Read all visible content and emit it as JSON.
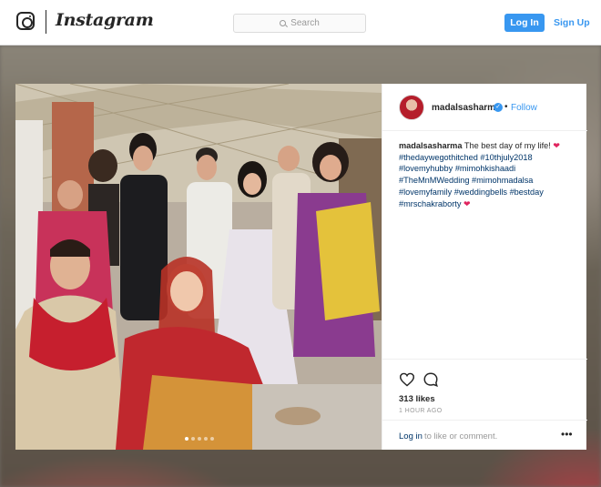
{
  "header": {
    "brand": "Instagram",
    "search_placeholder": "Search",
    "login_label": "Log In",
    "signup_label": "Sign Up"
  },
  "post": {
    "username": "madalsasharma",
    "follow_label": "Follow",
    "dot": "•",
    "caption_user": "madalsasharma",
    "caption_text": "The best day of my life!",
    "hashtags": [
      "#thedaywegothitched",
      "#10thjuly2018",
      "#lovemyhubby",
      "#mimohkishaadi",
      "#TheMnMWedding",
      "#mimohmadalsa",
      "#lovemyfamily",
      "#weddingbells",
      "#bestday",
      "#mrschakraborty"
    ],
    "likes": "313 likes",
    "time": "1 HOUR AGO",
    "login_link": "Log in",
    "comment_prompt": "to like or comment.",
    "more": "•••",
    "carousel": {
      "count": 5,
      "active": 0
    }
  },
  "colors": {
    "accent": "#3897f0",
    "heart": "#e0245e",
    "hashtag": "#003569"
  },
  "icons": {
    "logo": "instagram-glyph-icon",
    "search": "search-icon",
    "verified": "verified-badge-icon",
    "like": "heart-outline-icon",
    "comment": "comment-bubble-icon",
    "more": "more-options-icon"
  }
}
